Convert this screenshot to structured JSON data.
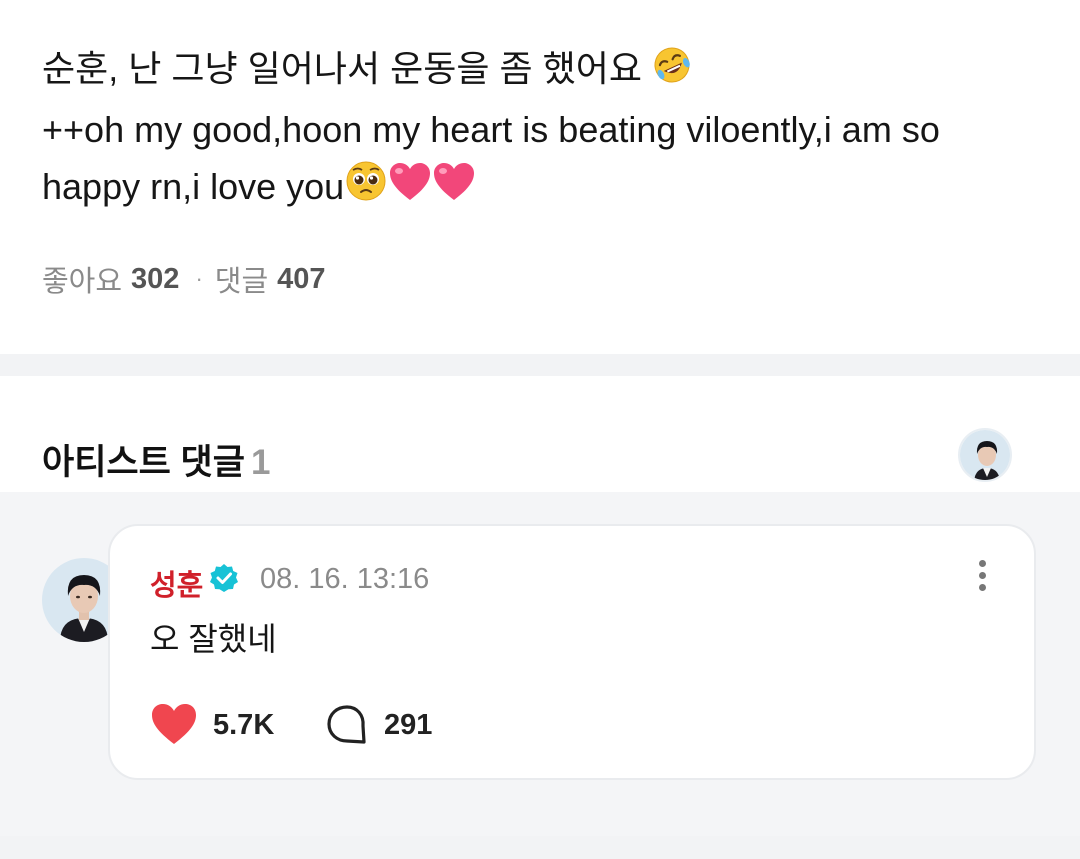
{
  "post": {
    "line1": "순훈, 난 그냥 일어나서 운동을 좀 했어요 ",
    "line2": "++oh my good,hoon my heart is beating viloently,i  am so",
    "line3": "happy rn,i love you",
    "emoji": {
      "line1": "rolling-on-floor-laughing",
      "line3": [
        "pleading-face",
        "pink-heart",
        "pink-heart"
      ]
    },
    "likes_label": "좋아요",
    "likes_count": "302",
    "comments_label": "댓글",
    "comments_count": "407"
  },
  "artist_comments": {
    "title": "아티스트 댓글",
    "count": "1"
  },
  "comment": {
    "author": "성훈",
    "verified": true,
    "timestamp": "08. 16. 13:16",
    "text": "오 잘했네",
    "like_count": "5.7K",
    "reply_count": "291"
  },
  "colors": {
    "author_name": "#d0202a",
    "verified_badge": "#17c2d6",
    "like_heart": "#f0464f",
    "section_background": "#f4f5f7"
  }
}
